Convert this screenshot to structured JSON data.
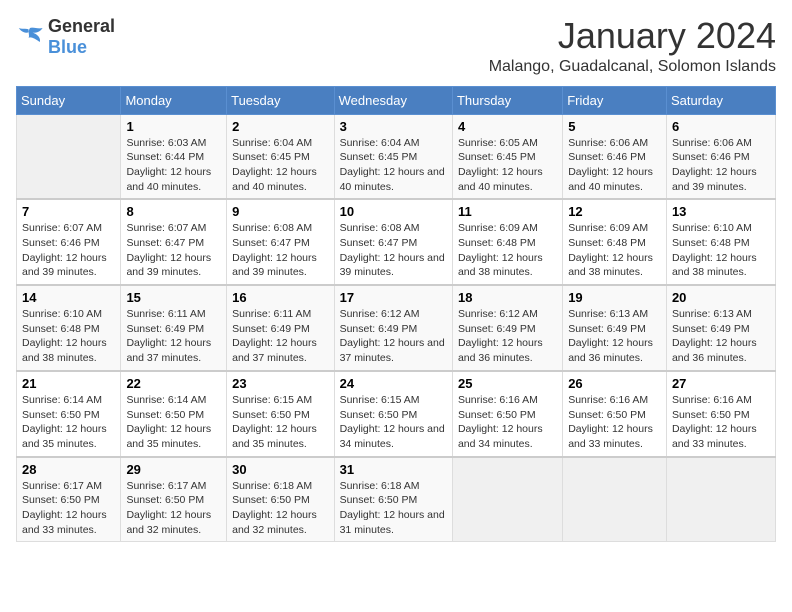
{
  "logo": {
    "general": "General",
    "blue": "Blue"
  },
  "title": "January 2024",
  "subtitle": "Malango, Guadalcanal, Solomon Islands",
  "days_of_week": [
    "Sunday",
    "Monday",
    "Tuesday",
    "Wednesday",
    "Thursday",
    "Friday",
    "Saturday"
  ],
  "weeks": [
    [
      {
        "day": "",
        "info": ""
      },
      {
        "day": "1",
        "sunrise": "6:03 AM",
        "sunset": "6:44 PM",
        "daylight": "12 hours and 40 minutes."
      },
      {
        "day": "2",
        "sunrise": "6:04 AM",
        "sunset": "6:45 PM",
        "daylight": "12 hours and 40 minutes."
      },
      {
        "day": "3",
        "sunrise": "6:04 AM",
        "sunset": "6:45 PM",
        "daylight": "12 hours and 40 minutes."
      },
      {
        "day": "4",
        "sunrise": "6:05 AM",
        "sunset": "6:45 PM",
        "daylight": "12 hours and 40 minutes."
      },
      {
        "day": "5",
        "sunrise": "6:06 AM",
        "sunset": "6:46 PM",
        "daylight": "12 hours and 40 minutes."
      },
      {
        "day": "6",
        "sunrise": "6:06 AM",
        "sunset": "6:46 PM",
        "daylight": "12 hours and 39 minutes."
      }
    ],
    [
      {
        "day": "7",
        "sunrise": "6:07 AM",
        "sunset": "6:46 PM",
        "daylight": "12 hours and 39 minutes."
      },
      {
        "day": "8",
        "sunrise": "6:07 AM",
        "sunset": "6:47 PM",
        "daylight": "12 hours and 39 minutes."
      },
      {
        "day": "9",
        "sunrise": "6:08 AM",
        "sunset": "6:47 PM",
        "daylight": "12 hours and 39 minutes."
      },
      {
        "day": "10",
        "sunrise": "6:08 AM",
        "sunset": "6:47 PM",
        "daylight": "12 hours and 39 minutes."
      },
      {
        "day": "11",
        "sunrise": "6:09 AM",
        "sunset": "6:48 PM",
        "daylight": "12 hours and 38 minutes."
      },
      {
        "day": "12",
        "sunrise": "6:09 AM",
        "sunset": "6:48 PM",
        "daylight": "12 hours and 38 minutes."
      },
      {
        "day": "13",
        "sunrise": "6:10 AM",
        "sunset": "6:48 PM",
        "daylight": "12 hours and 38 minutes."
      }
    ],
    [
      {
        "day": "14",
        "sunrise": "6:10 AM",
        "sunset": "6:48 PM",
        "daylight": "12 hours and 38 minutes."
      },
      {
        "day": "15",
        "sunrise": "6:11 AM",
        "sunset": "6:49 PM",
        "daylight": "12 hours and 37 minutes."
      },
      {
        "day": "16",
        "sunrise": "6:11 AM",
        "sunset": "6:49 PM",
        "daylight": "12 hours and 37 minutes."
      },
      {
        "day": "17",
        "sunrise": "6:12 AM",
        "sunset": "6:49 PM",
        "daylight": "12 hours and 37 minutes."
      },
      {
        "day": "18",
        "sunrise": "6:12 AM",
        "sunset": "6:49 PM",
        "daylight": "12 hours and 36 minutes."
      },
      {
        "day": "19",
        "sunrise": "6:13 AM",
        "sunset": "6:49 PM",
        "daylight": "12 hours and 36 minutes."
      },
      {
        "day": "20",
        "sunrise": "6:13 AM",
        "sunset": "6:49 PM",
        "daylight": "12 hours and 36 minutes."
      }
    ],
    [
      {
        "day": "21",
        "sunrise": "6:14 AM",
        "sunset": "6:50 PM",
        "daylight": "12 hours and 35 minutes."
      },
      {
        "day": "22",
        "sunrise": "6:14 AM",
        "sunset": "6:50 PM",
        "daylight": "12 hours and 35 minutes."
      },
      {
        "day": "23",
        "sunrise": "6:15 AM",
        "sunset": "6:50 PM",
        "daylight": "12 hours and 35 minutes."
      },
      {
        "day": "24",
        "sunrise": "6:15 AM",
        "sunset": "6:50 PM",
        "daylight": "12 hours and 34 minutes."
      },
      {
        "day": "25",
        "sunrise": "6:16 AM",
        "sunset": "6:50 PM",
        "daylight": "12 hours and 34 minutes."
      },
      {
        "day": "26",
        "sunrise": "6:16 AM",
        "sunset": "6:50 PM",
        "daylight": "12 hours and 33 minutes."
      },
      {
        "day": "27",
        "sunrise": "6:16 AM",
        "sunset": "6:50 PM",
        "daylight": "12 hours and 33 minutes."
      }
    ],
    [
      {
        "day": "28",
        "sunrise": "6:17 AM",
        "sunset": "6:50 PM",
        "daylight": "12 hours and 33 minutes."
      },
      {
        "day": "29",
        "sunrise": "6:17 AM",
        "sunset": "6:50 PM",
        "daylight": "12 hours and 32 minutes."
      },
      {
        "day": "30",
        "sunrise": "6:18 AM",
        "sunset": "6:50 PM",
        "daylight": "12 hours and 32 minutes."
      },
      {
        "day": "31",
        "sunrise": "6:18 AM",
        "sunset": "6:50 PM",
        "daylight": "12 hours and 31 minutes."
      },
      {
        "day": "",
        "info": ""
      },
      {
        "day": "",
        "info": ""
      },
      {
        "day": "",
        "info": ""
      }
    ]
  ]
}
